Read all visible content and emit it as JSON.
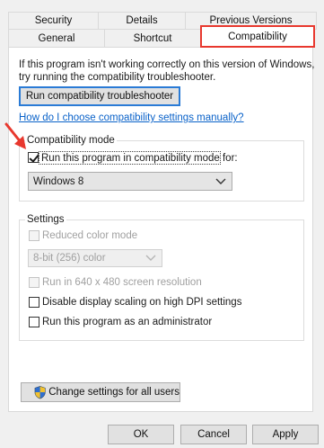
{
  "tabs_row1": [
    {
      "label": "Security"
    },
    {
      "label": "Details"
    },
    {
      "label": "Previous Versions"
    }
  ],
  "tabs_row2": [
    {
      "label": "General"
    },
    {
      "label": "Shortcut"
    },
    {
      "label": "Compatibility"
    }
  ],
  "intro": {
    "line1": "If this program isn't working correctly on this version of Windows,",
    "line2": "try running the compatibility troubleshooter."
  },
  "troubleshooter_button": "Run compatibility troubleshooter",
  "help_link": "How do I choose compatibility settings manually?",
  "compat_mode": {
    "group_label": "Compatibility mode",
    "checkbox_label": "Run this program in compatibility mode for:",
    "checked": true,
    "selected_os": "Windows 8"
  },
  "settings": {
    "group_label": "Settings",
    "reduced_color": {
      "label": "Reduced color mode",
      "checked": false,
      "enabled": false
    },
    "color_depth": {
      "value": "8-bit (256) color",
      "enabled": false
    },
    "run_640": {
      "label": "Run in 640 x 480 screen resolution",
      "checked": false,
      "enabled": false
    },
    "disable_dpi": {
      "label": "Disable display scaling on high DPI settings",
      "checked": false,
      "enabled": true
    },
    "run_admin": {
      "label": "Run this program as an administrator",
      "checked": false,
      "enabled": true
    }
  },
  "change_all_users_button": "Change settings for all users",
  "footer": {
    "ok": "OK",
    "cancel": "Cancel",
    "apply": "Apply"
  },
  "colors": {
    "highlight_red": "#e8382e",
    "link_blue": "#0a62c9",
    "primary_border": "#2a7bd6"
  },
  "icons": {
    "shield": "uac-shield-icon",
    "annotation_arrow": "red-arrow-icon"
  }
}
